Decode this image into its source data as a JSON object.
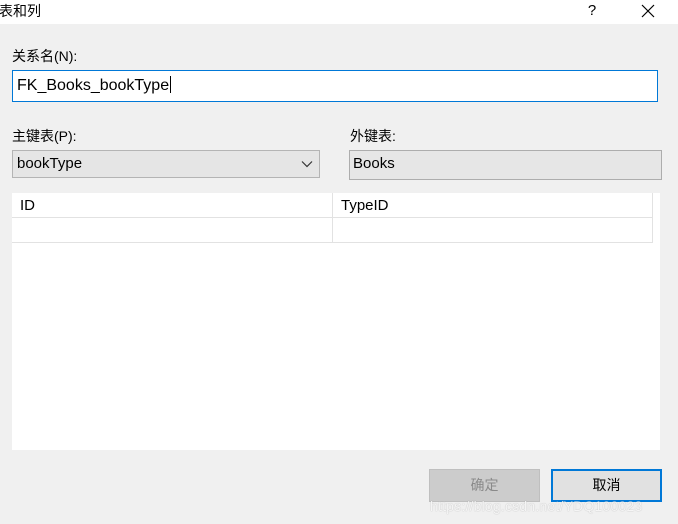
{
  "window": {
    "title": "表和列",
    "help_label": "?"
  },
  "relationship": {
    "label": "关系名(N):",
    "value": "FK_Books_bookType"
  },
  "primary_table": {
    "label": "主键表(P):",
    "selected": "bookType"
  },
  "foreign_table": {
    "label": "外键表:",
    "value": "Books"
  },
  "columns_grid": {
    "rows": [
      [
        "ID",
        "TypeID"
      ],
      [
        "",
        ""
      ]
    ]
  },
  "buttons": {
    "ok_label": "确定",
    "cancel_label": "取消"
  },
  "watermark": "https://blog.csdn.net/YDQ100023",
  "colors": {
    "accent": "#0078d7",
    "background": "#f0f0f0"
  }
}
